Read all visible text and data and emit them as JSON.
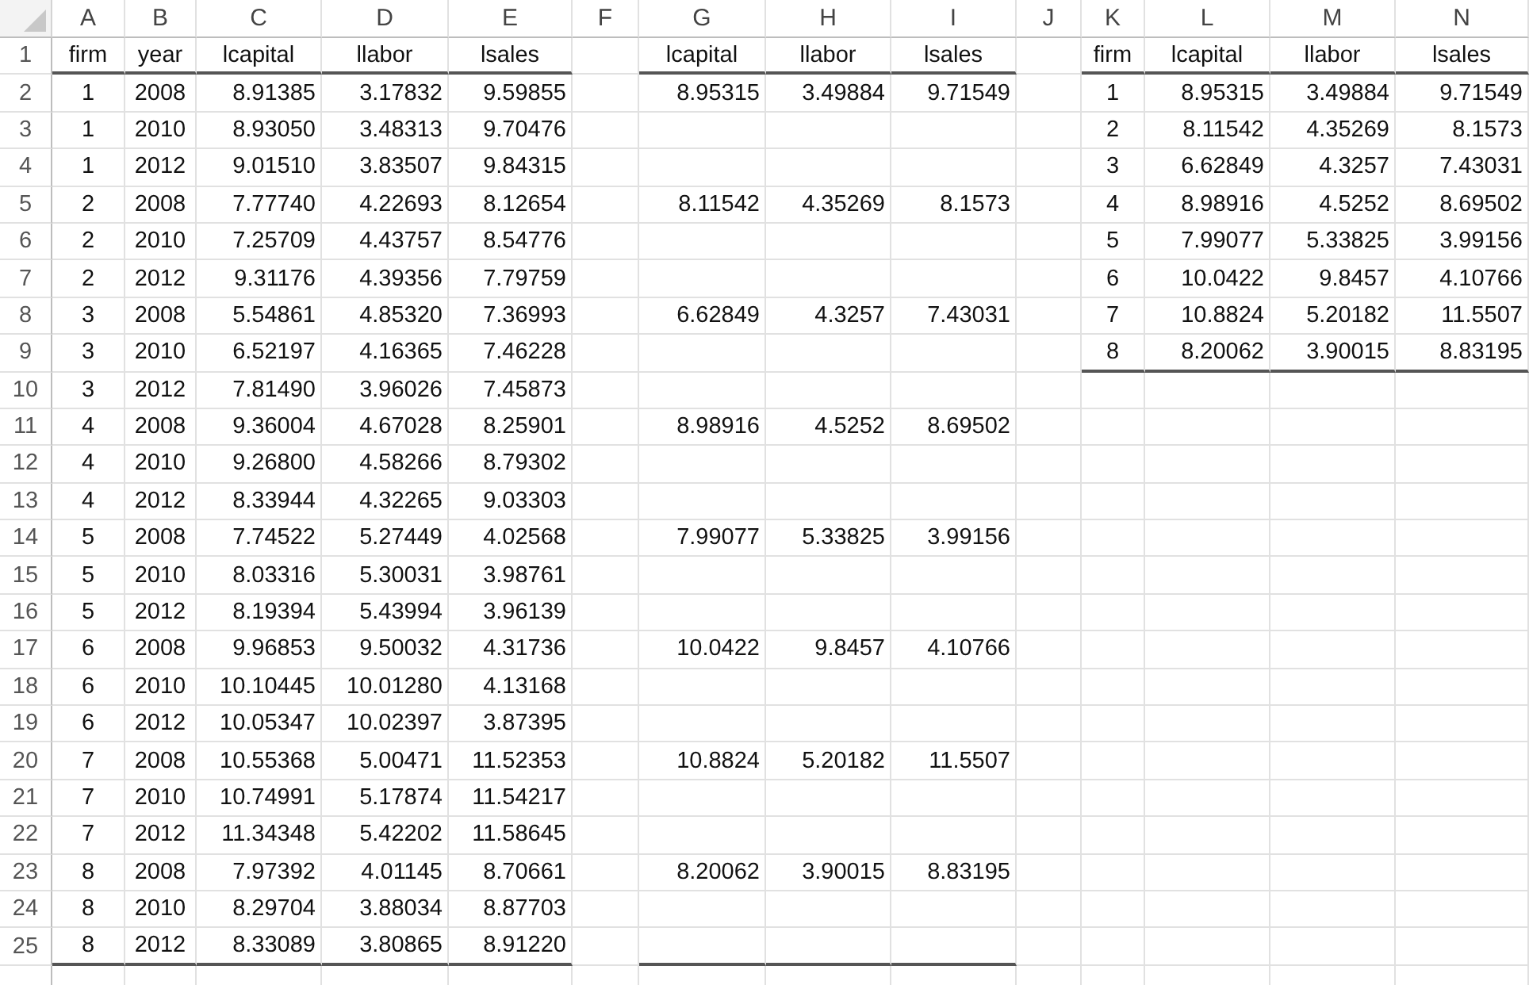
{
  "sheet": {
    "columns": [
      {
        "letter": "A",
        "kind": "label"
      },
      {
        "letter": "B",
        "kind": "label"
      },
      {
        "letter": "C",
        "kind": "number"
      },
      {
        "letter": "D",
        "kind": "number"
      },
      {
        "letter": "E",
        "kind": "number"
      },
      {
        "letter": "F",
        "kind": "number"
      },
      {
        "letter": "G",
        "kind": "number"
      },
      {
        "letter": "H",
        "kind": "number"
      },
      {
        "letter": "I",
        "kind": "number"
      },
      {
        "letter": "J",
        "kind": "number"
      },
      {
        "letter": "K",
        "kind": "label"
      },
      {
        "letter": "L",
        "kind": "number"
      },
      {
        "letter": "M",
        "kind": "number"
      },
      {
        "letter": "N",
        "kind": "number"
      }
    ],
    "rows": [
      {
        "number": "1",
        "kind": "header",
        "ruled": {
          "A": true,
          "B": true,
          "C": true,
          "D": true,
          "E": true,
          "G": true,
          "H": true,
          "I": true,
          "K": true,
          "L": true,
          "M": true,
          "N": true
        },
        "cells": {
          "A": "firm",
          "B": "year",
          "C": "lcapital",
          "D": "llabor",
          "E": "lsales",
          "G": "lcapital",
          "H": "llabor",
          "I": "lsales",
          "K": "firm",
          "L": "lcapital",
          "M": "llabor",
          "N": "lsales"
        }
      },
      {
        "number": "2",
        "cells": {
          "A": "1",
          "B": "2008",
          "C": "8.91385",
          "D": "3.17832",
          "E": "9.59855",
          "G": "8.95315",
          "H": "3.49884",
          "I": "9.71549",
          "K": "1",
          "L": "8.95315",
          "M": "3.49884",
          "N": "9.71549"
        }
      },
      {
        "number": "3",
        "cells": {
          "A": "1",
          "B": "2010",
          "C": "8.93050",
          "D": "3.48313",
          "E": "9.70476",
          "K": "2",
          "L": "8.11542",
          "M": "4.35269",
          "N": "8.1573"
        }
      },
      {
        "number": "4",
        "cells": {
          "A": "1",
          "B": "2012",
          "C": "9.01510",
          "D": "3.83507",
          "E": "9.84315",
          "K": "3",
          "L": "6.62849",
          "M": "4.3257",
          "N": "7.43031"
        }
      },
      {
        "number": "5",
        "cells": {
          "A": "2",
          "B": "2008",
          "C": "7.77740",
          "D": "4.22693",
          "E": "8.12654",
          "G": "8.11542",
          "H": "4.35269",
          "I": "8.1573",
          "K": "4",
          "L": "8.98916",
          "M": "4.5252",
          "N": "8.69502"
        }
      },
      {
        "number": "6",
        "cells": {
          "A": "2",
          "B": "2010",
          "C": "7.25709",
          "D": "4.43757",
          "E": "8.54776",
          "K": "5",
          "L": "7.99077",
          "M": "5.33825",
          "N": "3.99156"
        }
      },
      {
        "number": "7",
        "cells": {
          "A": "2",
          "B": "2012",
          "C": "9.31176",
          "D": "4.39356",
          "E": "7.79759",
          "K": "6",
          "L": "10.0422",
          "M": "9.8457",
          "N": "4.10766"
        }
      },
      {
        "number": "8",
        "cells": {
          "A": "3",
          "B": "2008",
          "C": "5.54861",
          "D": "4.85320",
          "E": "7.36993",
          "G": "6.62849",
          "H": "4.3257",
          "I": "7.43031",
          "K": "7",
          "L": "10.8824",
          "M": "5.20182",
          "N": "11.5507"
        }
      },
      {
        "number": "9",
        "ruled": {
          "K": true,
          "L": true,
          "M": true,
          "N": true
        },
        "cells": {
          "A": "3",
          "B": "2010",
          "C": "6.52197",
          "D": "4.16365",
          "E": "7.46228",
          "K": "8",
          "L": "8.20062",
          "M": "3.90015",
          "N": "8.83195"
        }
      },
      {
        "number": "10",
        "cells": {
          "A": "3",
          "B": "2012",
          "C": "7.81490",
          "D": "3.96026",
          "E": "7.45873"
        }
      },
      {
        "number": "11",
        "cells": {
          "A": "4",
          "B": "2008",
          "C": "9.36004",
          "D": "4.67028",
          "E": "8.25901",
          "G": "8.98916",
          "H": "4.5252",
          "I": "8.69502"
        }
      },
      {
        "number": "12",
        "cells": {
          "A": "4",
          "B": "2010",
          "C": "9.26800",
          "D": "4.58266",
          "E": "8.79302"
        }
      },
      {
        "number": "13",
        "cells": {
          "A": "4",
          "B": "2012",
          "C": "8.33944",
          "D": "4.32265",
          "E": "9.03303"
        }
      },
      {
        "number": "14",
        "cells": {
          "A": "5",
          "B": "2008",
          "C": "7.74522",
          "D": "5.27449",
          "E": "4.02568",
          "G": "7.99077",
          "H": "5.33825",
          "I": "3.99156"
        }
      },
      {
        "number": "15",
        "cells": {
          "A": "5",
          "B": "2010",
          "C": "8.03316",
          "D": "5.30031",
          "E": "3.98761"
        }
      },
      {
        "number": "16",
        "cells": {
          "A": "5",
          "B": "2012",
          "C": "8.19394",
          "D": "5.43994",
          "E": "3.96139"
        }
      },
      {
        "number": "17",
        "cells": {
          "A": "6",
          "B": "2008",
          "C": "9.96853",
          "D": "9.50032",
          "E": "4.31736",
          "G": "10.0422",
          "H": "9.8457",
          "I": "4.10766"
        }
      },
      {
        "number": "18",
        "cells": {
          "A": "6",
          "B": "2010",
          "C": "10.10445",
          "D": "10.01280",
          "E": "4.13168"
        }
      },
      {
        "number": "19",
        "cells": {
          "A": "6",
          "B": "2012",
          "C": "10.05347",
          "D": "10.02397",
          "E": "3.87395"
        }
      },
      {
        "number": "20",
        "cells": {
          "A": "7",
          "B": "2008",
          "C": "10.55368",
          "D": "5.00471",
          "E": "11.52353",
          "G": "10.8824",
          "H": "5.20182",
          "I": "11.5507"
        }
      },
      {
        "number": "21",
        "cells": {
          "A": "7",
          "B": "2010",
          "C": "10.74991",
          "D": "5.17874",
          "E": "11.54217"
        }
      },
      {
        "number": "22",
        "cells": {
          "A": "7",
          "B": "2012",
          "C": "11.34348",
          "D": "5.42202",
          "E": "11.58645"
        }
      },
      {
        "number": "23",
        "cells": {
          "A": "8",
          "B": "2008",
          "C": "7.97392",
          "D": "4.01145",
          "E": "8.70661",
          "G": "8.20062",
          "H": "3.90015",
          "I": "8.83195"
        }
      },
      {
        "number": "24",
        "cells": {
          "A": "8",
          "B": "2010",
          "C": "8.29704",
          "D": "3.88034",
          "E": "8.87703"
        }
      },
      {
        "number": "25",
        "ruled": {
          "A": true,
          "B": true,
          "C": true,
          "D": true,
          "E": true,
          "G": true,
          "H": true,
          "I": true
        },
        "cells": {
          "A": "8",
          "B": "2012",
          "C": "8.33089",
          "D": "3.80865",
          "E": "8.91220"
        }
      }
    ]
  }
}
